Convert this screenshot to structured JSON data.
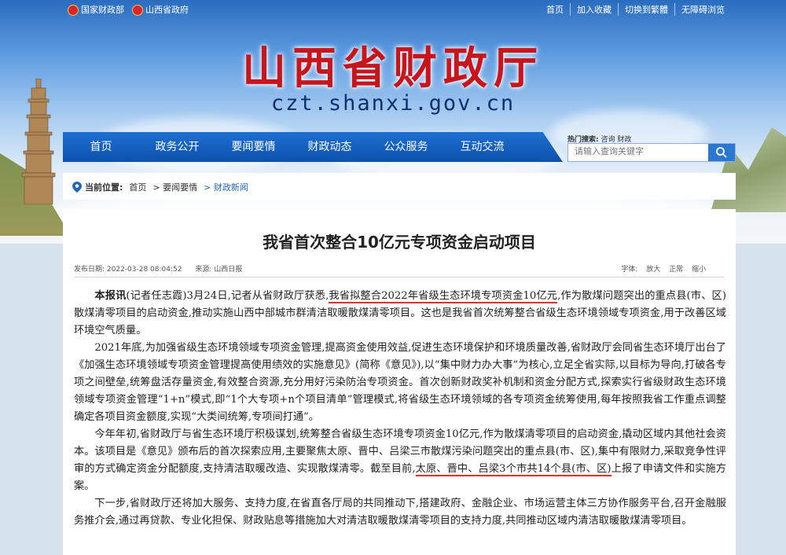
{
  "topbar": {
    "left_links": [
      "国家财政部",
      "山西省政府"
    ],
    "right_links": [
      "首页",
      "加入收藏",
      "切换到繁體",
      "无障碍浏览"
    ]
  },
  "site": {
    "title": "山西省财政厅",
    "domain": "czt.shanxi.gov.cn"
  },
  "nav": [
    "首页",
    "政务公开",
    "要闻要情",
    "财政动态",
    "公众服务",
    "互动交流"
  ],
  "search": {
    "hot_label": "热门搜索:",
    "hot_terms": "咨询 财政",
    "placeholder": "请输入查询关键字"
  },
  "breadcrumb": {
    "label": "当前位置:",
    "items": [
      "首页",
      "> 要闻要情",
      "> 财政新闻"
    ]
  },
  "article": {
    "title": "我省首次整合10亿元专项资金启动项目",
    "publish": "发布日期:  2022-03-28 08:04:52",
    "source": "来源:  山西日报",
    "font_label": "字体:",
    "font_options": [
      "放大",
      "正常",
      "缩小"
    ],
    "paragraphs": [
      {
        "lead": "本报讯",
        "a": "(记者任志霞)3月24日,记者从省财政厅获悉,",
        "highlight": "我省拟整合2022年省级生态环境专项资金10亿元",
        "b": ",作为散煤问题突出的重点县(市、区)散煤清零项目的启动资金,推动实施山西中部城市群清洁取暖散煤清零项目。这也是我省首次统筹整合省级生态环境领域专项资金,用于改善区域环境空气质量。"
      },
      {
        "text": "2021年底,为加强省级生态环境领域专项资金管理,提高资金使用效益,促进生态环境保护和环境质量改善,省财政厅会同省生态环境厅出台了《加强生态环境领域专项资金管理提高使用绩效的实施意见》(简称《意见》),以“集中财力办大事”为核心,立足全省实际,以目标为导向,打破各专项之间壁垒,统筹盘活存量资金,有效整合资源,充分用好污染防治专项资金。首次创新财政奖补机制和资金分配方式,探索实行省级财政生态环境领域专项资金管理“1+n”模式,即“1个大专项+n个项目清单”管理模式,将省级生态环境领域的各专项资金统筹使用,每年按照我省工作重点调整确定各项目资金额度,实现“大类间统筹,专项间打通”。"
      },
      {
        "a": "今年年初,省财政厅与省生态环境厅积极谋划,统筹整合省级生态环境专项资金10亿元,作为散煤清零项目的启动资金,撬动区域内其他社会资本。该项目是《意见》颁布后的首次探索应用,主要聚焦太原、晋中、吕梁三市散煤污染问题突出的重点县(市、区),集中有限财力,采取竞争性评审的方式确定资金分配额度,支持清洁取暖改造、实现散煤清零。截至目前,",
        "highlight": "太原、晋中、吕梁3个市共14个县(市、区)",
        "b": "上报了申请文件和实施方案。"
      },
      {
        "text": "下一步,省财政厅还将加大服务、支持力度,在省直各厅局的共同推动下,搭建政府、金融企业、市场运营主体三方协作服务平台,召开金融服务推介会,通过再贷款、专业化担保、财政贴息等措施加大对清洁取暖散煤清零项目的支持力度,共同推动区域内清洁取暖散煤清零项目。"
      }
    ]
  },
  "colors": {
    "nav_blue": "#1d6fd1",
    "title_red": "#c8141b",
    "highlight_red": "#e03131",
    "link_blue": "#2566b8"
  }
}
